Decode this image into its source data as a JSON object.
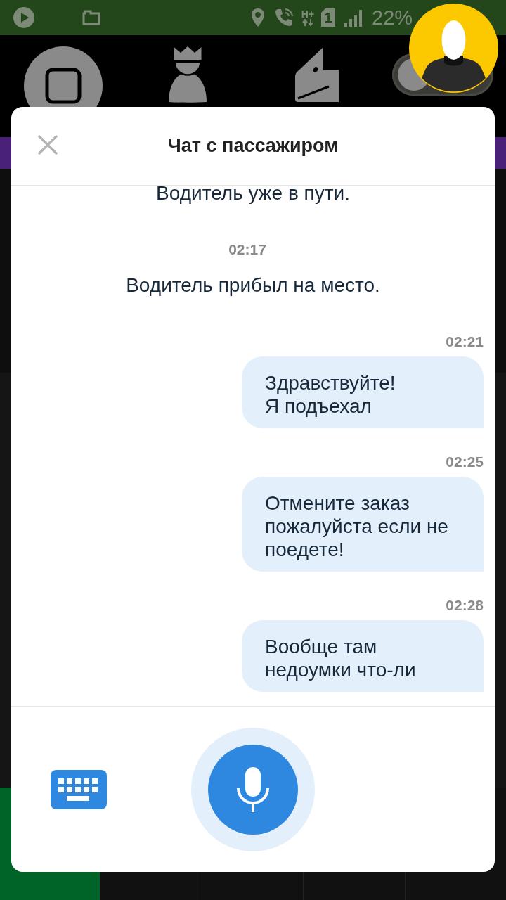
{
  "status_bar": {
    "network": "H+",
    "sim": "1",
    "battery": "22%"
  },
  "toolbar": {
    "toggle": {
      "on": false
    }
  },
  "chat": {
    "title": "Чат с пассажиром",
    "messages": [
      {
        "kind": "system",
        "text": "Водитель уже в пути."
      },
      {
        "kind": "system",
        "time": "02:17",
        "text": "Водитель прибыл на место."
      },
      {
        "kind": "outgoing",
        "time": "02:21",
        "text": "Здравствуйте!\nЯ подъехал"
      },
      {
        "kind": "outgoing",
        "time": "02:25",
        "text": "Отмените заказ пожалуйста если не поедете!"
      },
      {
        "kind": "outgoing",
        "time": "02:28",
        "text": "Вообще там\nнедоумки что-ли"
      }
    ]
  }
}
